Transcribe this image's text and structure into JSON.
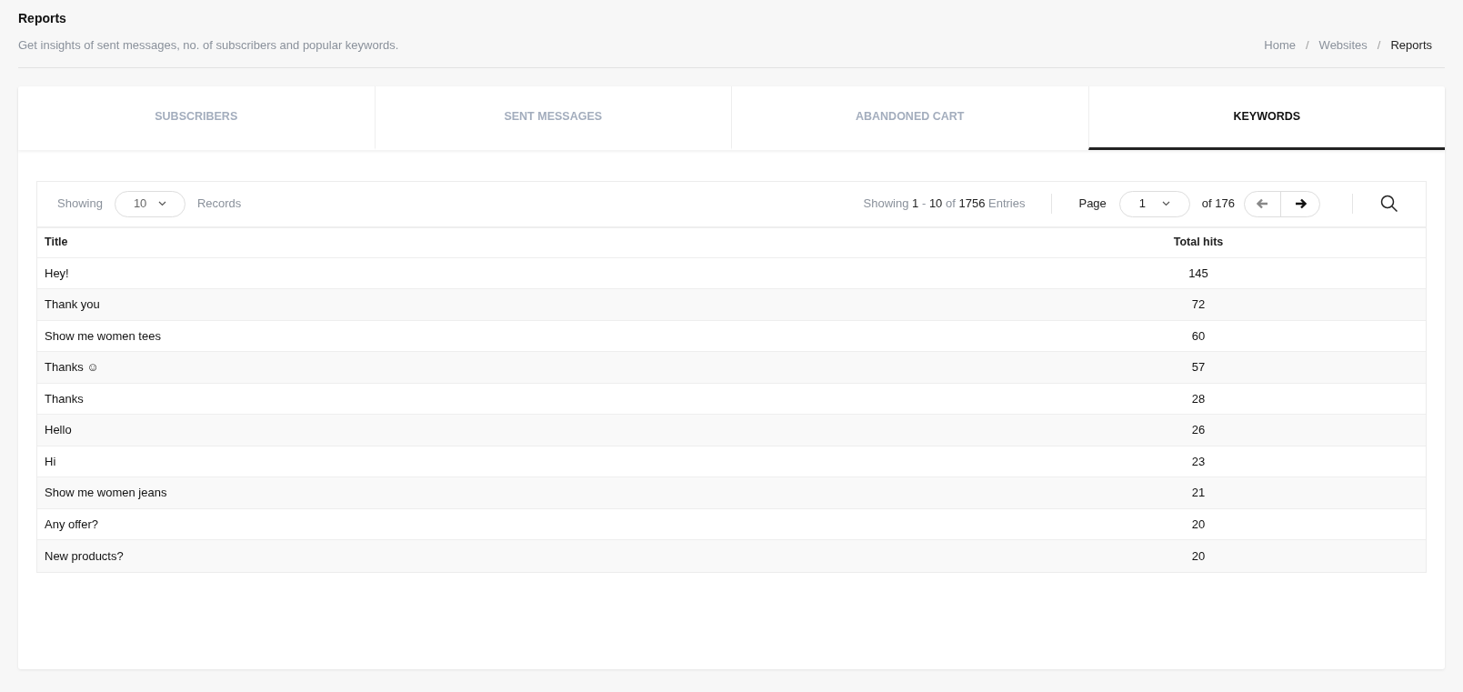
{
  "header": {
    "title": "Reports",
    "subtitle": "Get insights of sent messages, no. of subscribers and popular keywords."
  },
  "breadcrumb": [
    {
      "label": "Home",
      "current": false
    },
    {
      "label": "Websites",
      "current": false
    },
    {
      "label": "Reports",
      "current": true
    }
  ],
  "breadcrumb_separator": "/",
  "tabs": [
    {
      "label": "SUBSCRIBERS",
      "selected": false
    },
    {
      "label": "SENT MESSAGES",
      "selected": false
    },
    {
      "label": "ABANDONED CART",
      "selected": false
    },
    {
      "label": "KEYWORDS",
      "selected": true
    }
  ],
  "toolbar": {
    "showing_label": "Showing",
    "page_size": "10",
    "records_label": "Records",
    "summary": {
      "prefix": "Showing",
      "start": "1",
      "dash": "-",
      "end": "10",
      "of": "of",
      "total": "1756",
      "suffix": "Entries"
    },
    "page_label": "Page",
    "page": "1",
    "page_count": "of 176",
    "prev_disabled": true,
    "next_disabled": false
  },
  "table": {
    "columns": [
      "Title",
      "Total hits"
    ],
    "rows": [
      [
        "Hey!",
        "145"
      ],
      [
        "Thank you",
        "72"
      ],
      [
        "Show me women tees",
        "60"
      ],
      [
        "Thanks ☺",
        "57"
      ],
      [
        "Thanks",
        "28"
      ],
      [
        "Hello",
        "26"
      ],
      [
        "Hi",
        "23"
      ],
      [
        "Show me women jeans",
        "21"
      ],
      [
        "Any offer?",
        "20"
      ],
      [
        "New products?",
        "20"
      ]
    ]
  }
}
